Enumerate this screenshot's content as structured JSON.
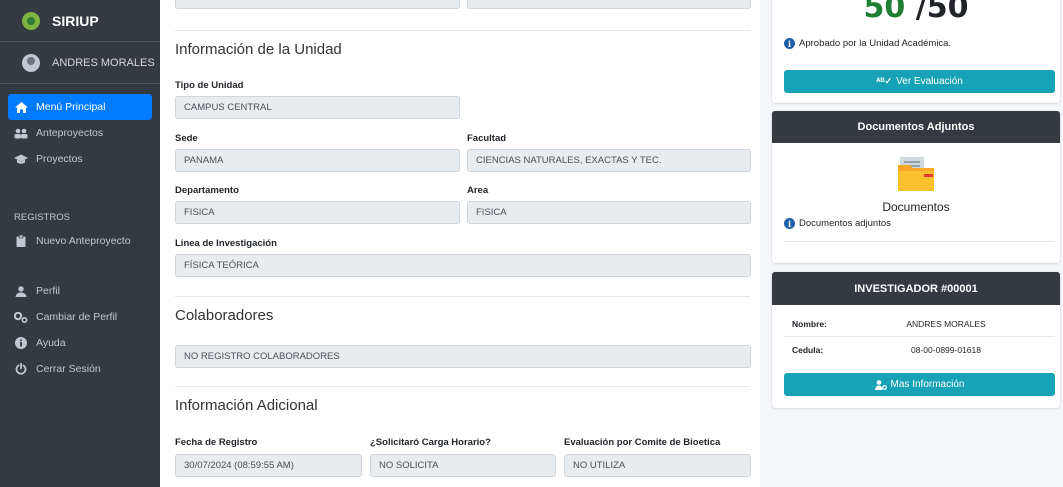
{
  "sidebar": {
    "brand": "SIRIUP",
    "user_name": "ANDRES MORALES",
    "items": [
      {
        "label": "Menú Principal"
      },
      {
        "label": "Anteproyectos"
      },
      {
        "label": "Proyectos"
      }
    ],
    "section_header": "REGISTROS",
    "registros_items": [
      {
        "label": "Nuevo Anteproyecto"
      }
    ],
    "account_items": [
      {
        "label": "Perfil"
      },
      {
        "label": "Cambiar de Perfil"
      },
      {
        "label": "Ayuda"
      },
      {
        "label": "Cerrar Sesión"
      }
    ]
  },
  "unidad": {
    "title": "Información de la Unidad",
    "tipo_label": "Tipo de Unidad",
    "tipo_value": "CAMPUS CENTRAL",
    "sede_label": "Sede",
    "sede_value": "PANAMA",
    "facultad_label": "Facultad",
    "facultad_value": "CIENCIAS NATURALES, EXACTAS Y TEC.",
    "departamento_label": "Departamento",
    "departamento_value": "FISICA",
    "area_label": "Area",
    "area_value": "FISICA",
    "linea_label": "Linea de Investigación",
    "linea_value": "FÍSICA TEÓRICA"
  },
  "colaboradores": {
    "title": "Colaboradores",
    "value": "NO REGISTRO COLABORADORES"
  },
  "adicional": {
    "title": "Información Adicional",
    "fecha_label": "Fecha de Registro",
    "fecha_value": "30/07/2024 (08:59:55 AM)",
    "carga_label": "¿Solicitaró Carga Horario?",
    "carga_value": "NO SOLICITA",
    "bioetica_label": "Evaluación por Comite de Bioetica",
    "bioetica_value": "NO UTILIZA"
  },
  "evaluacion": {
    "score": "50 /50",
    "score_color": "#1e7e34",
    "status": "Aprobado por la Unidad Académica.",
    "button": "Ver Evaluación"
  },
  "documentos": {
    "header": "Documentos Adjuntos",
    "folder_label": "Documentos",
    "note": "Documentos adjuntos"
  },
  "investigador": {
    "header": "INVESTIGADOR #00001",
    "nombre_label": "Nombre:",
    "nombre_value": "ANDRES MORALES",
    "cedula_label": "Cedula:",
    "cedula_value": "08-00-0899-01618",
    "button": "Mas Información"
  },
  "colors": {
    "sidebar_bg": "#343a40",
    "active_item": "#007bff",
    "info_button": "#17a2b8",
    "card_header": "#343a40"
  }
}
